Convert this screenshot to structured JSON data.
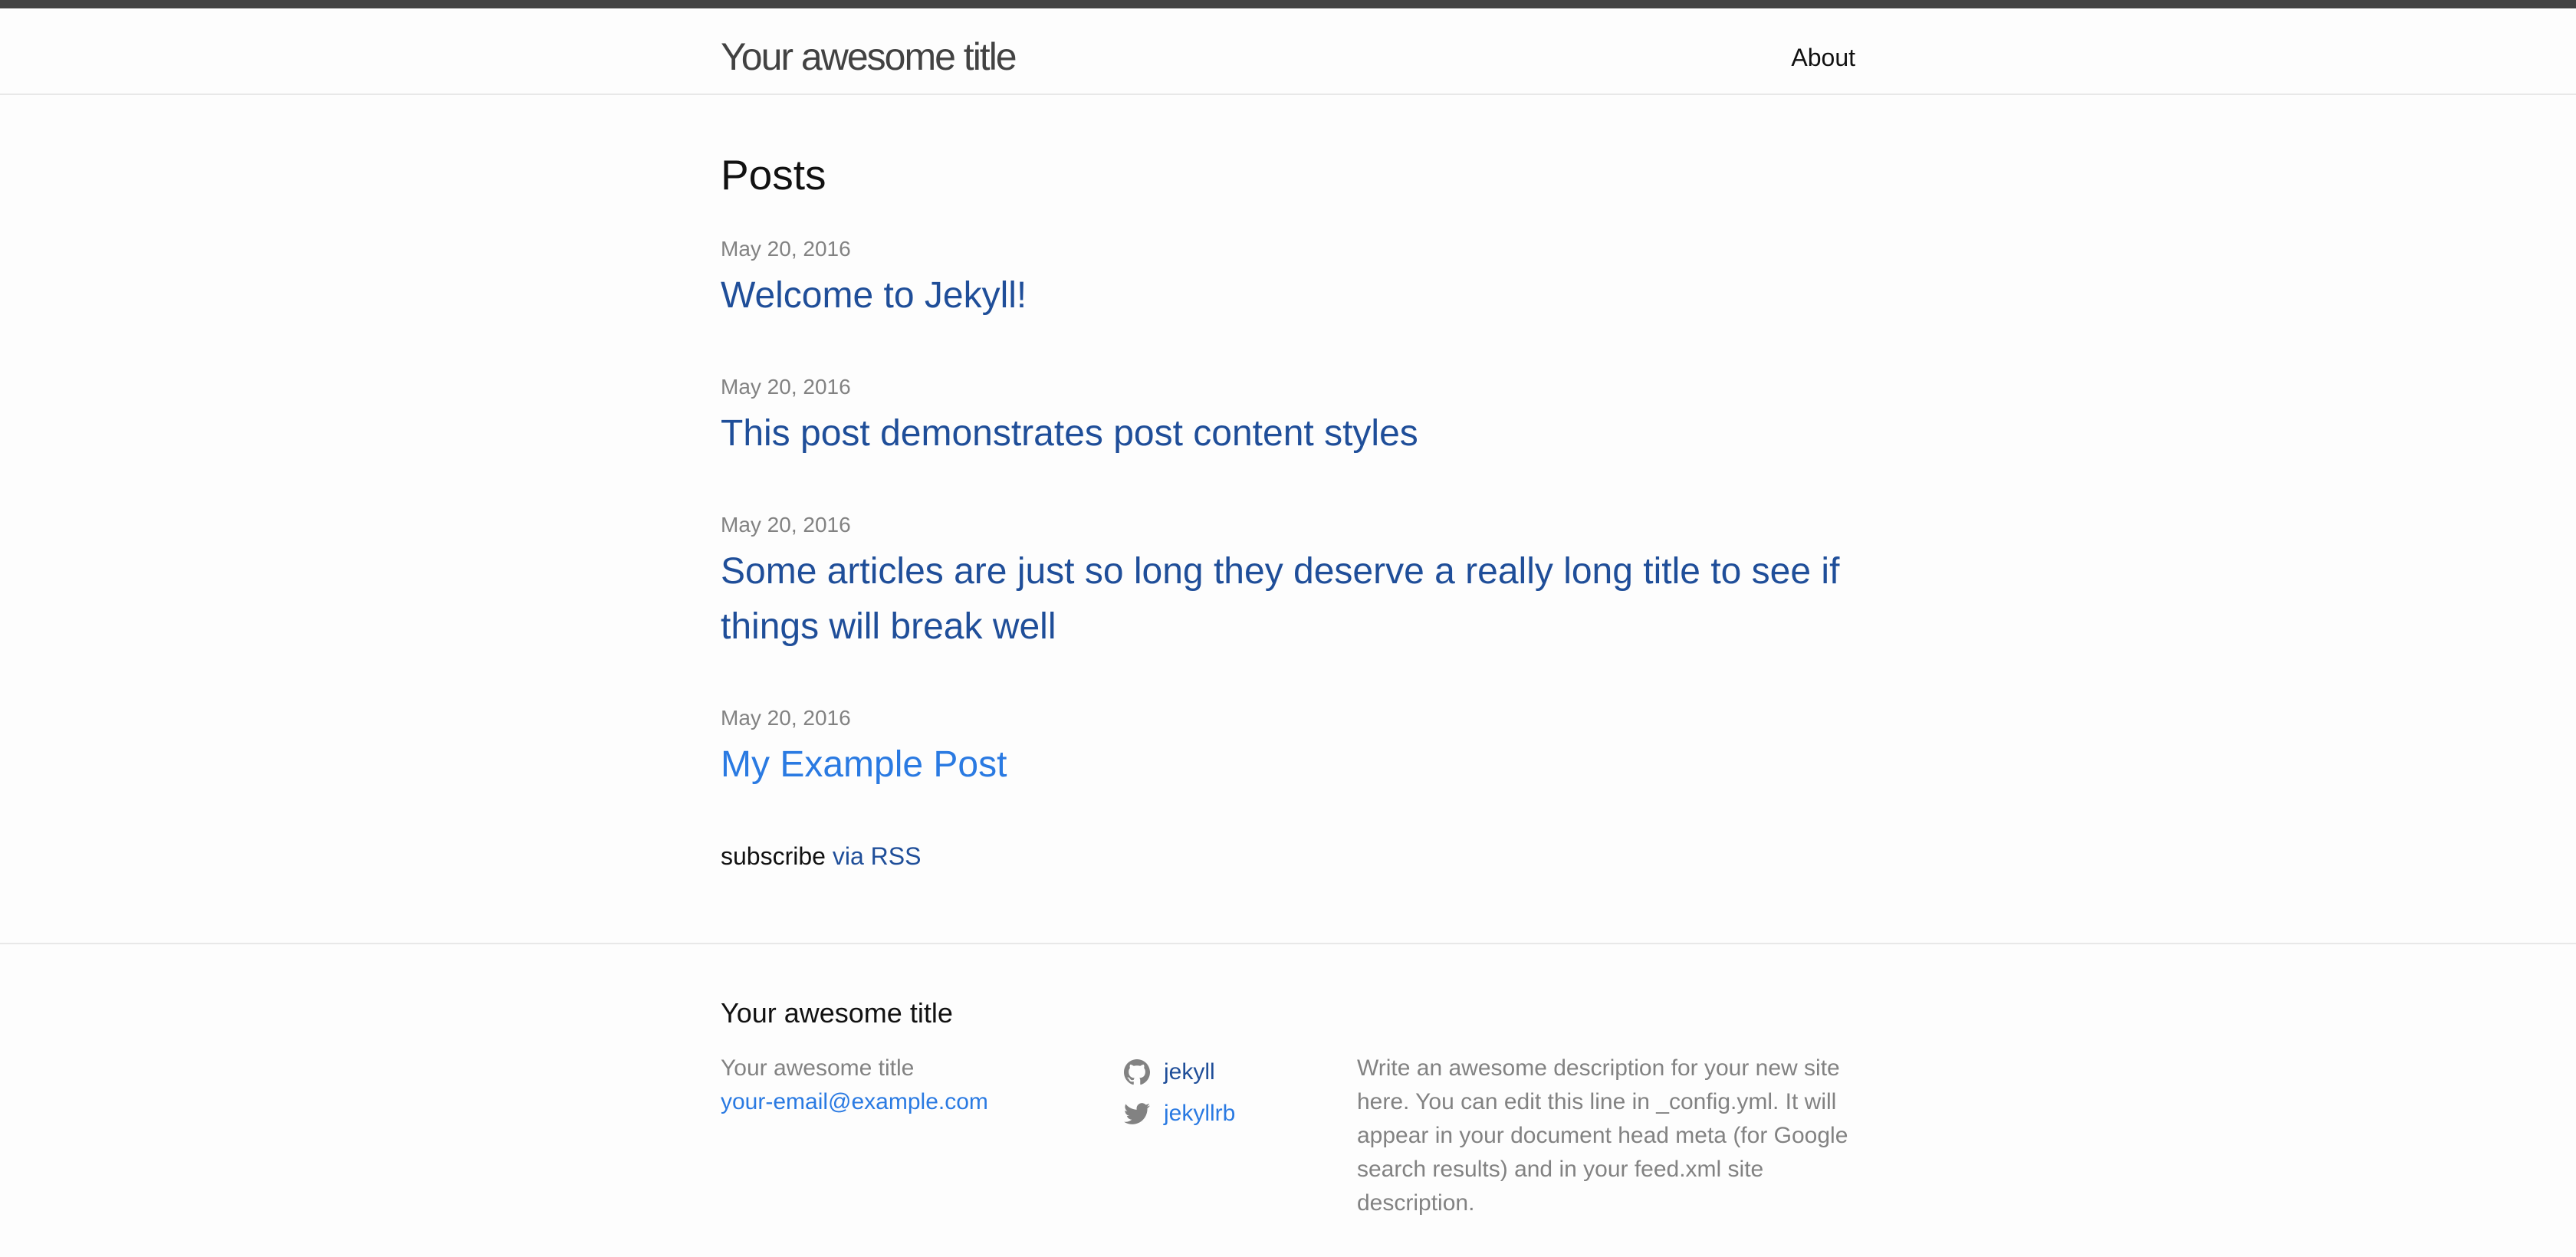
{
  "header": {
    "site_title": "Your awesome title",
    "nav": {
      "about": "About"
    }
  },
  "main": {
    "heading": "Posts",
    "posts": [
      {
        "date": "May 20, 2016",
        "title": "Welcome to Jekyll!"
      },
      {
        "date": "May 20, 2016",
        "title": "This post demonstrates post content styles"
      },
      {
        "date": "May 20, 2016",
        "title": "Some articles are just so long they deserve a really long title to see if things will break well"
      },
      {
        "date": "May 20, 2016",
        "title": "My Example Post"
      }
    ],
    "rss": {
      "prefix": "subscribe",
      "link": "via RSS"
    }
  },
  "footer": {
    "heading": "Your awesome title",
    "col1": {
      "name": "Your awesome title",
      "email": "your-email@example.com"
    },
    "social": [
      {
        "icon": "github-icon",
        "label": "jekyll"
      },
      {
        "icon": "twitter-icon",
        "label": "jekyllrb"
      }
    ],
    "description": "Write an awesome description for your new site here. You can edit this line in _config.yml. It will appear in your document head meta (for Google search results) and in your feed.xml site description."
  },
  "colors": {
    "link": "#1f4e99",
    "link_highlight": "#2a7ae2",
    "meta": "#828282",
    "topbar": "#424242"
  }
}
